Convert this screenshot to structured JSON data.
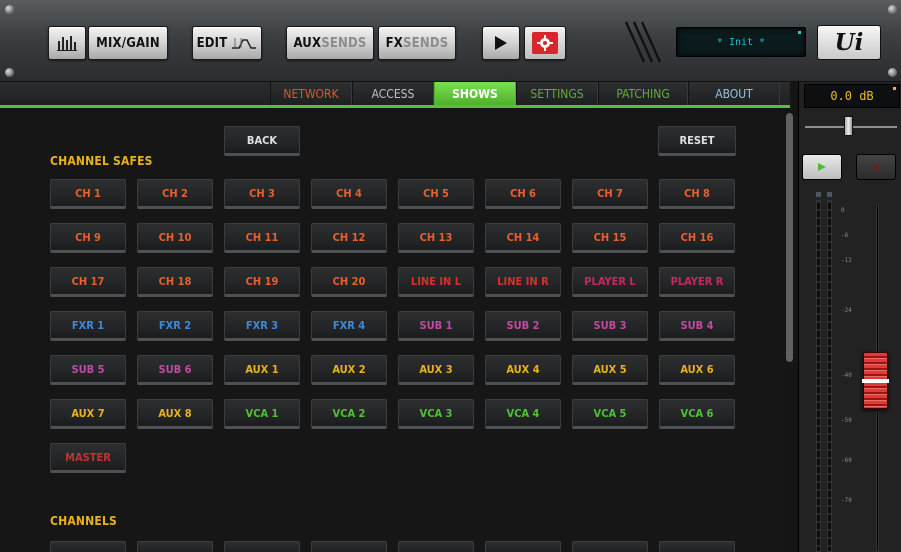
{
  "toolbar": {
    "mixgain_label": "MIX/GAIN",
    "edit_label": "EDIT",
    "auxsends_prefix": "AUX",
    "auxsends_suffix": "SENDS",
    "fxsends_prefix": "FX",
    "fxsends_suffix": "SENDS",
    "display_text": "* Init *",
    "logo_text": "Ui",
    "icons": {
      "mixgain": "mixer-bars-icon",
      "edit": "eq-curve-icon",
      "play": "play-icon",
      "settings": "gear-icon"
    }
  },
  "tabs": [
    {
      "label": "NETWORK",
      "active": false
    },
    {
      "label": "ACCESS",
      "active": false
    },
    {
      "label": "SHOWS",
      "active": true
    },
    {
      "label": "SETTINGS",
      "active": false
    },
    {
      "label": "PATCHING",
      "active": false
    },
    {
      "label": "ABOUT",
      "active": false
    }
  ],
  "main": {
    "back_label": "BACK",
    "reset_label": "RESET",
    "channel_safes_title": "CHANNEL SAFES",
    "channels_title": "CHANNELS",
    "safes_rows": [
      [
        {
          "label": "CH 1",
          "color": "#e8602c"
        },
        {
          "label": "CH 2",
          "color": "#e8602c"
        },
        {
          "label": "CH 3",
          "color": "#e8602c"
        },
        {
          "label": "CH 4",
          "color": "#e8602c"
        },
        {
          "label": "CH 5",
          "color": "#e8602c"
        },
        {
          "label": "CH 6",
          "color": "#e8602c"
        },
        {
          "label": "CH 7",
          "color": "#e8602c"
        },
        {
          "label": "CH 8",
          "color": "#e8602c"
        }
      ],
      [
        {
          "label": "CH 9",
          "color": "#e8602c"
        },
        {
          "label": "CH 10",
          "color": "#e8602c"
        },
        {
          "label": "CH 11",
          "color": "#e8602c"
        },
        {
          "label": "CH 12",
          "color": "#e8602c"
        },
        {
          "label": "CH 13",
          "color": "#e8602c"
        },
        {
          "label": "CH 14",
          "color": "#e8602c"
        },
        {
          "label": "CH 15",
          "color": "#e8602c"
        },
        {
          "label": "CH 16",
          "color": "#e8602c"
        }
      ],
      [
        {
          "label": "CH 17",
          "color": "#e8602c"
        },
        {
          "label": "CH 18",
          "color": "#e8602c"
        },
        {
          "label": "CH 19",
          "color": "#e8602c"
        },
        {
          "label": "CH 20",
          "color": "#e8602c"
        },
        {
          "label": "LINE IN L",
          "color": "#d8302c"
        },
        {
          "label": "LINE IN R",
          "color": "#d8302c"
        },
        {
          "label": "PLAYER L",
          "color": "#c42a5e"
        },
        {
          "label": "PLAYER R",
          "color": "#c42a5e"
        }
      ],
      [
        {
          "label": "FXR 1",
          "color": "#3d8ad8"
        },
        {
          "label": "FXR 2",
          "color": "#3d8ad8"
        },
        {
          "label": "FXR 3",
          "color": "#3d8ad8"
        },
        {
          "label": "FXR 4",
          "color": "#3d8ad8"
        },
        {
          "label": "SUB 1",
          "color": "#c24aa3"
        },
        {
          "label": "SUB 2",
          "color": "#c24aa3"
        },
        {
          "label": "SUB 3",
          "color": "#c24aa3"
        },
        {
          "label": "SUB 4",
          "color": "#c24aa3"
        }
      ],
      [
        {
          "label": "SUB 5",
          "color": "#c24aa3"
        },
        {
          "label": "SUB 6",
          "color": "#c24aa3"
        },
        {
          "label": "AUX 1",
          "color": "#e8b21e"
        },
        {
          "label": "AUX 2",
          "color": "#e8b21e"
        },
        {
          "label": "AUX 3",
          "color": "#e8b21e"
        },
        {
          "label": "AUX 4",
          "color": "#e8b21e"
        },
        {
          "label": "AUX 5",
          "color": "#e8b21e"
        },
        {
          "label": "AUX 6",
          "color": "#e8b21e"
        }
      ],
      [
        {
          "label": "AUX 7",
          "color": "#e8b21e"
        },
        {
          "label": "AUX 8",
          "color": "#e8b21e"
        },
        {
          "label": "VCA 1",
          "color": "#4fc236"
        },
        {
          "label": "VCA 2",
          "color": "#4fc236"
        },
        {
          "label": "VCA 3",
          "color": "#4fc236"
        },
        {
          "label": "VCA 4",
          "color": "#4fc236"
        },
        {
          "label": "VCA 5",
          "color": "#4fc236"
        },
        {
          "label": "VCA 6",
          "color": "#4fc236"
        }
      ],
      [
        {
          "label": "MASTER",
          "color": "#c23232"
        }
      ]
    ]
  },
  "strip": {
    "db_value": "0.0 dB",
    "meter_scale": [
      "0",
      "-6",
      "-12",
      "-24",
      "-40",
      "-50",
      "-60",
      "-70"
    ]
  }
}
